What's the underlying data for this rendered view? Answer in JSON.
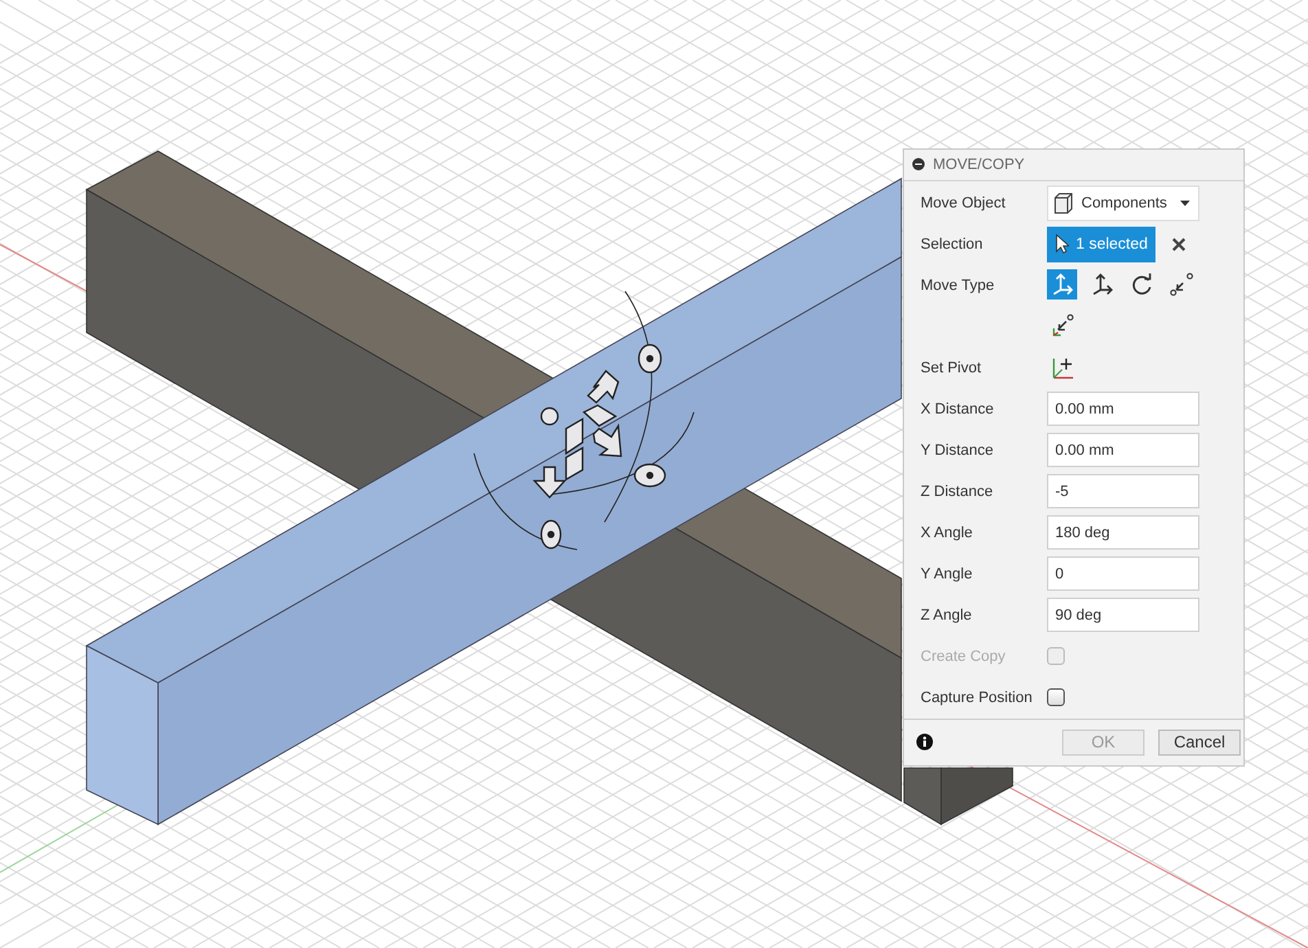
{
  "dialog": {
    "title": "MOVE/COPY",
    "rows": [
      {
        "kind": "dropdown",
        "label": "Move Object",
        "value": "Components"
      },
      {
        "kind": "selection",
        "label": "Selection",
        "value": "1 selected"
      },
      {
        "kind": "tools",
        "label": "Move Type",
        "options": [
          {
            "selected": true
          },
          {
            "selected": false
          },
          {
            "selected": false
          },
          {
            "selected": false
          },
          {
            "selected": false
          }
        ]
      },
      {
        "kind": "pivot",
        "label": "Set Pivot"
      },
      {
        "kind": "field",
        "label": "X Distance",
        "value": "0.00 mm"
      },
      {
        "kind": "field",
        "label": "Y Distance",
        "value": "0.00 mm"
      },
      {
        "kind": "field",
        "label": "Z Distance",
        "value": "-5"
      },
      {
        "kind": "field",
        "label": "X Angle",
        "value": "180 deg"
      },
      {
        "kind": "field",
        "label": "Y Angle",
        "value": "0"
      },
      {
        "kind": "field",
        "label": "Z Angle",
        "value": "90 deg"
      },
      {
        "kind": "checkbox",
        "label": "Create Copy",
        "checked": false,
        "disabled": true
      },
      {
        "kind": "checkbox",
        "label": "Capture Position",
        "checked": false,
        "disabled": false
      }
    ],
    "buttons": [
      {
        "label": "OK",
        "disabled": true
      },
      {
        "label": "Cancel",
        "disabled": false
      }
    ]
  }
}
